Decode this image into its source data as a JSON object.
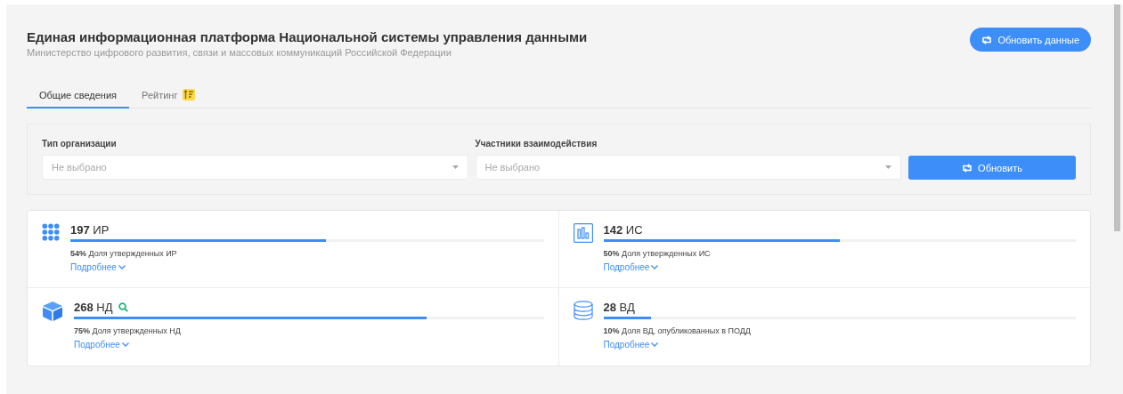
{
  "header": {
    "title": "Единая информационная платформа Национальной системы управления данными",
    "subtitle": "Министерство цифрового развития, связи и массовых коммуникаций Российской Федерации",
    "refresh_button": "Обновить данные"
  },
  "tabs": [
    {
      "label": "Общие сведения",
      "selected": true,
      "badge": false
    },
    {
      "label": "Рейтинг",
      "selected": false,
      "badge": true
    }
  ],
  "filters": [
    {
      "label": "Тип организации",
      "placeholder": "Не выбрано"
    },
    {
      "label": "Участники взаимодействия",
      "placeholder": "Не выбрано"
    }
  ],
  "apply_button": "Обновить",
  "stats": [
    {
      "kind": "grid",
      "count": "197",
      "unit": "ИР",
      "search": false,
      "level": 0.54,
      "caption": "**54%** Доля утвержденных ИР",
      "more": "Подробнее"
    },
    {
      "kind": "chart",
      "count": "142",
      "unit": "ИС",
      "search": false,
      "level": 0.5,
      "caption": "**50%** Доля утвержденных ИС",
      "more": "Подробнее"
    },
    {
      "kind": "cube",
      "count": "268",
      "unit": "НД",
      "search": true,
      "level": 0.75,
      "caption": "**75%** Доля утвержденных НД",
      "more": "Подробнее"
    },
    {
      "kind": "database",
      "count": "28",
      "unit": "ВД",
      "search": false,
      "level": 0.1,
      "caption": "**10%** Доля ВД, опубликованных в ПОДД",
      "more": "Подробнее"
    }
  ]
}
